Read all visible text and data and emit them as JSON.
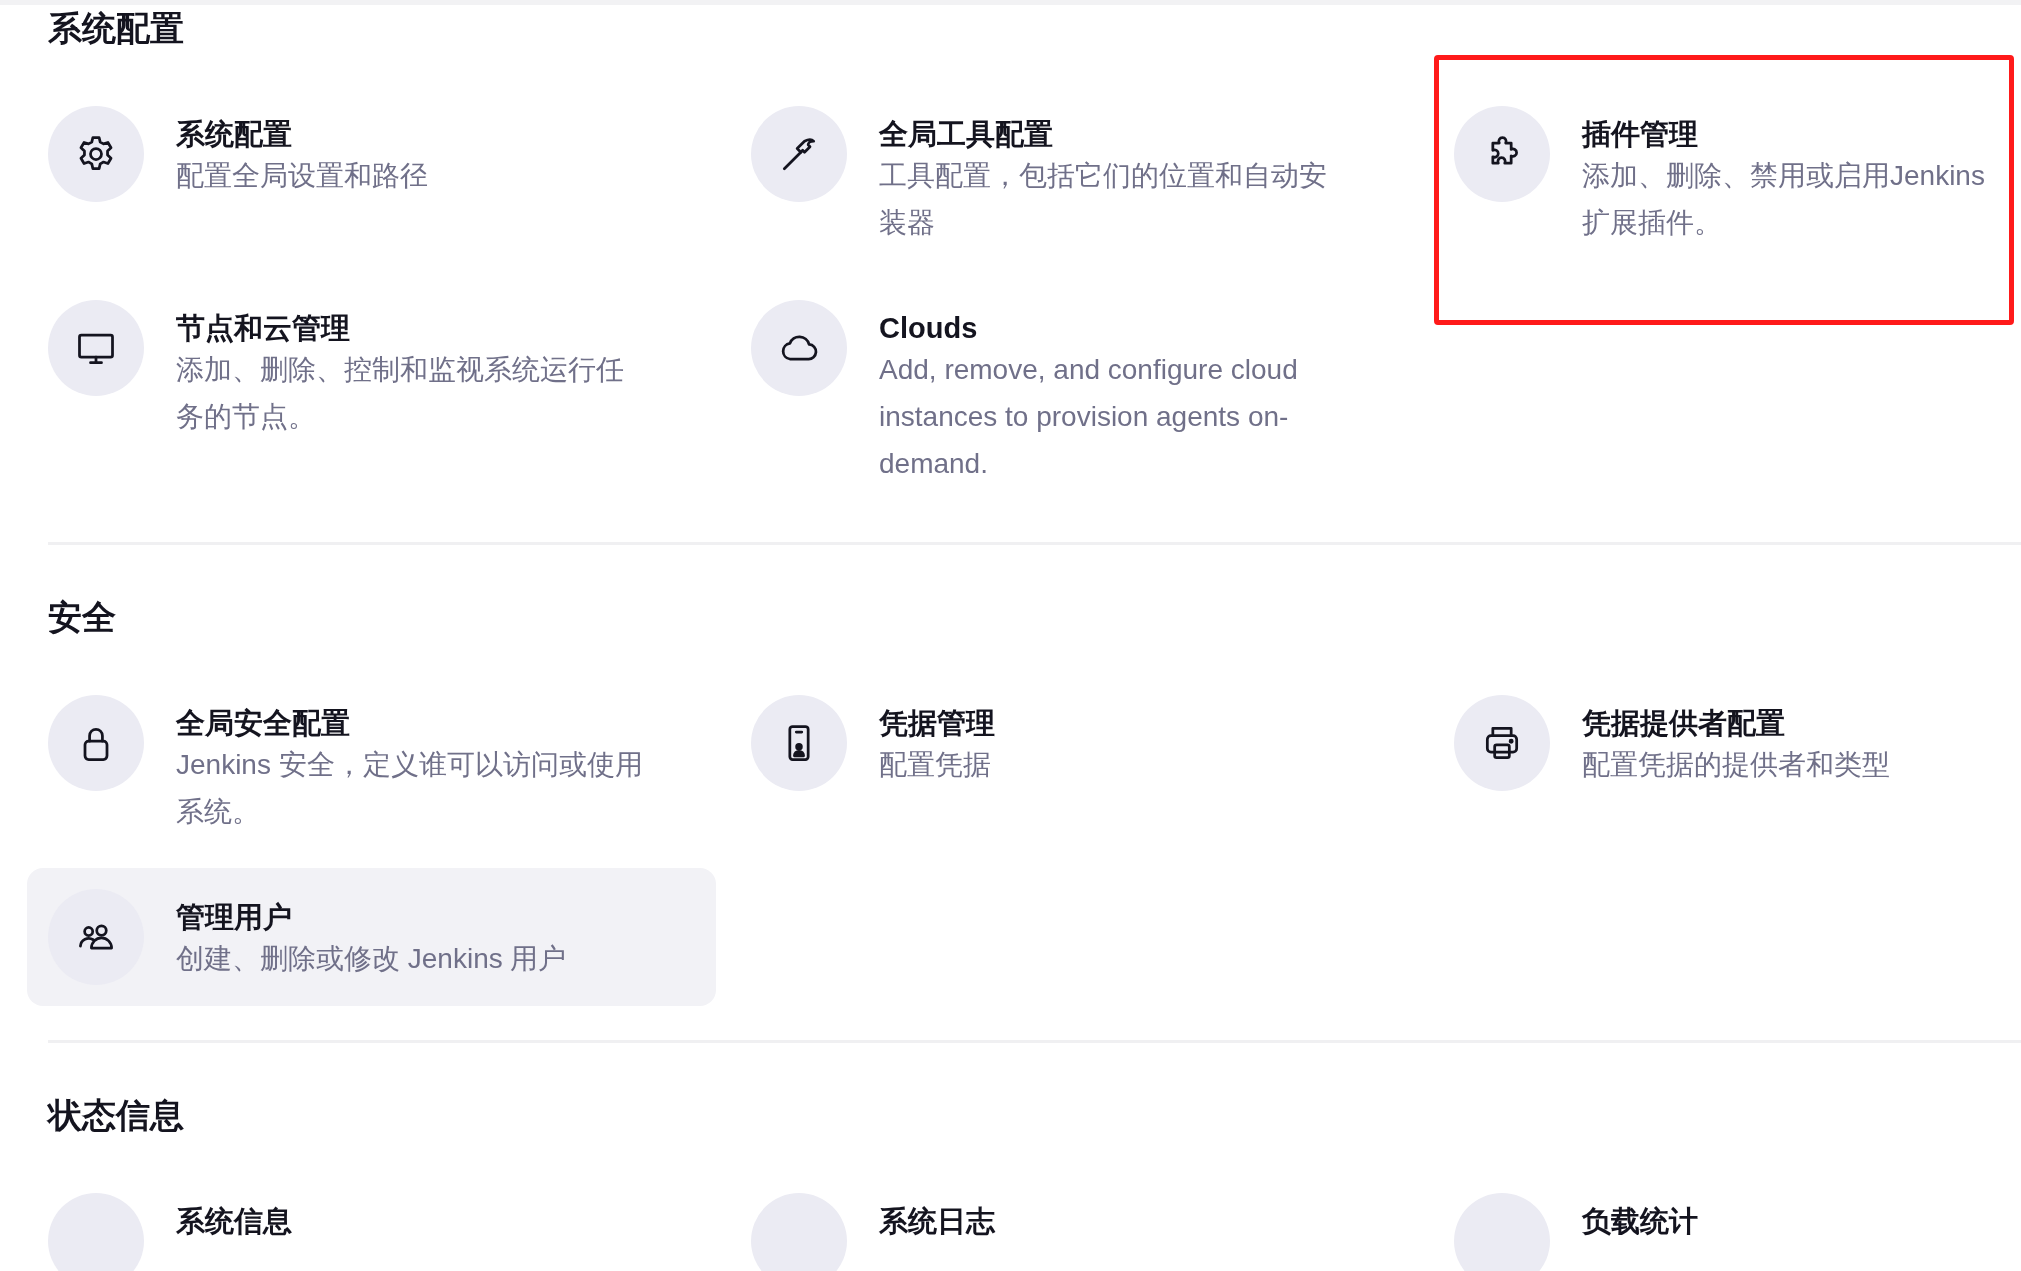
{
  "sections": [
    {
      "title": "系统配置",
      "items": [
        {
          "kind": "gear",
          "title": "系统配置",
          "description": [
            "配置全局设置和路径"
          ],
          "hovered": false,
          "annotated": false
        },
        {
          "kind": "hammer",
          "title": "全局工具配置",
          "description": [
            "工具配置，包括它们的位置和自动安",
            "装器"
          ],
          "hovered": false,
          "annotated": false
        },
        {
          "kind": "puzzle",
          "title": "插件管理",
          "description": [
            "添加、删除、禁用或启用Jenkins",
            "扩展插件。"
          ],
          "hovered": false,
          "annotated": true
        },
        {
          "kind": "monitor",
          "title": "节点和云管理",
          "description": [
            "添加、删除、控制和监视系统运行任",
            "务的节点。"
          ],
          "hovered": false,
          "annotated": false
        },
        {
          "kind": "cloud",
          "title": "Clouds",
          "description": [
            "Add, remove, and configure cloud",
            "instances to provision agents on-",
            "demand."
          ],
          "hovered": false,
          "annotated": false
        }
      ]
    },
    {
      "title": "安全",
      "items": [
        {
          "kind": "lock",
          "title": "全局安全配置",
          "description": [
            "Jenkins 安全，定义谁可以访问或使用",
            "系统。"
          ],
          "hovered": false,
          "annotated": false
        },
        {
          "kind": "id-card",
          "title": "凭据管理",
          "description": [
            "配置凭据"
          ],
          "hovered": false,
          "annotated": false
        },
        {
          "kind": "printer",
          "title": "凭据提供者配置",
          "description": [
            "配置凭据的提供者和类型"
          ],
          "hovered": false,
          "annotated": false
        },
        {
          "kind": "users",
          "title": "管理用户",
          "description": [
            "创建、删除或修改 Jenkins 用户"
          ],
          "hovered": true,
          "annotated": false
        }
      ]
    },
    {
      "title": "状态信息",
      "items": [
        {
          "title": "系统信息",
          "hovered": false,
          "annotated": false
        },
        {
          "title": "系统日志",
          "hovered": false,
          "annotated": false
        },
        {
          "title": "负载统计",
          "hovered": false,
          "annotated": false
        }
      ]
    }
  ]
}
